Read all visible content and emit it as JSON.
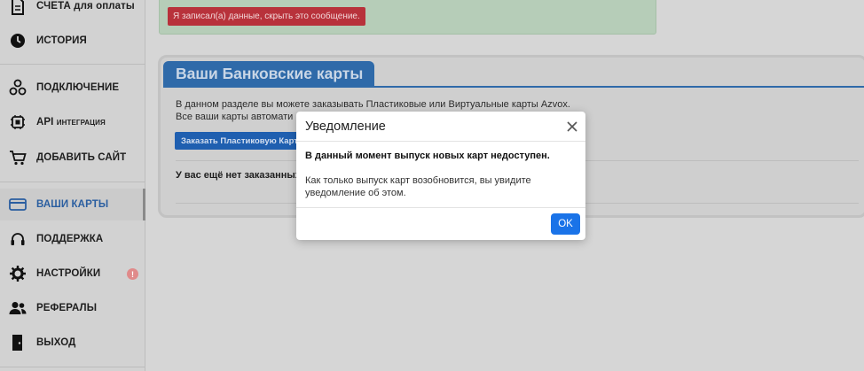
{
  "sidebar": {
    "items": [
      {
        "id": "bills",
        "label": "СЧЕТА для оплаты",
        "icon": "document-icon"
      },
      {
        "id": "history",
        "label": "ИСТОРИЯ",
        "icon": "clock-icon"
      },
      {
        "id": "connection",
        "label": "ПОДКЛЮЧЕНИЕ",
        "icon": "network-icon"
      },
      {
        "id": "api",
        "label": "API",
        "sub": "ИНТЕГРАЦИЯ",
        "icon": "chip-icon"
      },
      {
        "id": "add-site",
        "label": "ДОБАВИТЬ САЙТ",
        "icon": "cart-icon"
      },
      {
        "id": "cards",
        "label": "ВАШИ КАРТЫ",
        "icon": "credit-card-icon",
        "active": true
      },
      {
        "id": "support",
        "label": "ПОДДЕРЖКА",
        "icon": "headset-icon"
      },
      {
        "id": "settings",
        "label": "НАСТРОЙКИ",
        "icon": "gear-icon"
      },
      {
        "id": "referrals",
        "label": "РЕФЕРАЛЫ",
        "icon": "users-icon"
      },
      {
        "id": "logout",
        "label": "ВЫХОД",
        "icon": "door-exit-icon"
      }
    ],
    "settings_badge": "!"
  },
  "alert": {
    "dismiss_label": "Я записал(а) данные, скрыть это сообщение."
  },
  "cards_section": {
    "title": "Ваши Банковские карты",
    "desc_line1": "В данном разделе вы можете заказывать Пластиковые или Виртуальные карты Azvox.",
    "desc_line2": "Все ваши карты автомати",
    "order_button": "Заказать Пластиковую Карту",
    "empty_text": "У вас ещё нет заказанных карт"
  },
  "modal": {
    "title": "Уведомление",
    "bold_text": "В данный момент выпуск новых карт недоступен.",
    "text": "Как только выпуск карт возобновится, вы увидите уведомление об этом.",
    "ok_label": "OK"
  },
  "colors": {
    "accent": "#2f6aa9",
    "primary_button": "#1a73e8",
    "alert_button": "#b8323b"
  }
}
